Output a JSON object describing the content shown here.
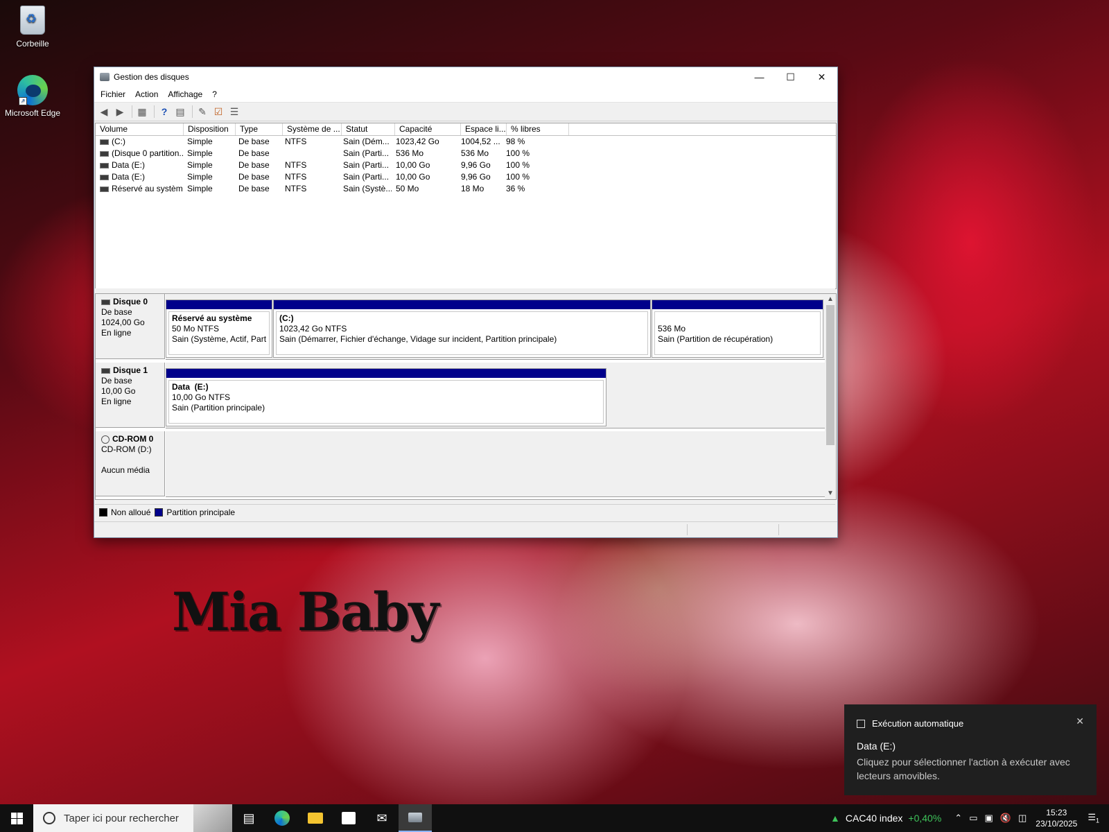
{
  "desktop": {
    "icons": [
      {
        "label": "Corbeille"
      },
      {
        "label": "Microsoft Edge"
      }
    ],
    "wallpaper_text": "Mia Baby"
  },
  "window": {
    "title": "Gestion des disques",
    "menu": [
      "Fichier",
      "Action",
      "Affichage",
      "?"
    ],
    "columns": [
      "Volume",
      "Disposition",
      "Type",
      "Système de ...",
      "Statut",
      "Capacité",
      "Espace li...",
      "% libres"
    ],
    "rows": [
      [
        "(C:)",
        "Simple",
        "De base",
        "NTFS",
        "Sain (Dém...",
        "1023,42 Go",
        "1004,52 ...",
        "98 %"
      ],
      [
        "(Disque 0 partition...",
        "Simple",
        "De base",
        "",
        "Sain (Parti...",
        "536 Mo",
        "536 Mo",
        "100 %"
      ],
      [
        "Data (E:)",
        "Simple",
        "De base",
        "NTFS",
        "Sain (Parti...",
        "10,00 Go",
        "9,96 Go",
        "100 %"
      ],
      [
        "Data (E:)",
        "Simple",
        "De base",
        "NTFS",
        "Sain (Parti...",
        "10,00 Go",
        "9,96 Go",
        "100 %"
      ],
      [
        "Réservé au système",
        "Simple",
        "De base",
        "NTFS",
        "Sain (Systè...",
        "50 Mo",
        "18 Mo",
        "36 %"
      ]
    ],
    "disks": [
      {
        "name": "Disque 0",
        "type": "De base",
        "size": "1024,00 Go",
        "state": "En ligne",
        "partitions": [
          {
            "title": "Réservé au système",
            "size": "50 Mo NTFS",
            "status": "Sain (Système, Actif, Partiti"
          },
          {
            "title": "(C:)",
            "size": "1023,42 Go NTFS",
            "status": "Sain (Démarrer, Fichier d'échange, Vidage sur incident, Partition principale)"
          },
          {
            "title": "",
            "size": "536 Mo",
            "status": "Sain (Partition de récupération)"
          }
        ]
      },
      {
        "name": "Disque 1",
        "type": "De base",
        "size": "10,00 Go",
        "state": "En ligne",
        "partitions": [
          {
            "title": "Data  (E:)",
            "size": "10,00 Go NTFS",
            "status": "Sain (Partition principale)"
          }
        ]
      },
      {
        "name": "CD-ROM 0",
        "type": "CD-ROM (D:)",
        "size": "",
        "state": "Aucun média",
        "partitions": []
      }
    ],
    "legend": [
      {
        "label": "Non alloué",
        "color": "#000000"
      },
      {
        "label": "Partition principale",
        "color": "#00008b"
      }
    ]
  },
  "notification": {
    "app": "Exécution automatique",
    "title": "Data (E:)",
    "body": "Cliquez pour sélectionner l'action à exécuter avec lecteurs amovibles."
  },
  "taskbar": {
    "search_placeholder": "Taper ici pour rechercher",
    "stock_name": "CAC40 index",
    "stock_change": "+0,40%",
    "time": "15:23",
    "date": "23/10/2025",
    "notification_count": "1"
  },
  "colors": {
    "primary_partition": "#00008b",
    "stock_positive": "#3ec35a"
  }
}
